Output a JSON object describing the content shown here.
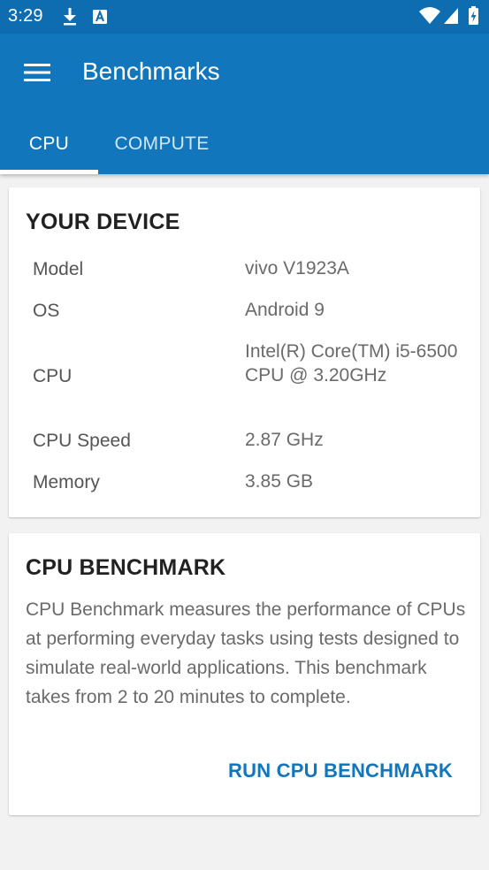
{
  "status_bar": {
    "time": "3:29",
    "icons": [
      "download-icon",
      "font-a-icon",
      "wifi-icon",
      "signal-icon",
      "battery-icon"
    ]
  },
  "app_bar": {
    "title": "Benchmarks",
    "menu_icon": "hamburger-menu-icon"
  },
  "tabs": [
    {
      "label": "CPU",
      "selected": true
    },
    {
      "label": "COMPUTE",
      "selected": false
    }
  ],
  "device_card": {
    "title": "YOUR DEVICE",
    "specs": [
      {
        "label": "Model",
        "value": "vivo V1923A"
      },
      {
        "label": "OS",
        "value": "Android 9"
      },
      {
        "label": "CPU",
        "value": "Intel(R) Core(TM) i5-6500 CPU @ 3.20GHz"
      },
      {
        "label": "CPU Speed",
        "value": "2.87 GHz"
      },
      {
        "label": "Memory",
        "value": "3.85 GB"
      }
    ]
  },
  "benchmark_card": {
    "title": "CPU BENCHMARK",
    "description": "CPU Benchmark measures the performance of CPUs at performing everyday tasks using tests designed to simulate real-world applications. This benchmark takes from 2 to 20 minutes to complete.",
    "run_label": "RUN CPU BENCHMARK"
  },
  "colors": {
    "status_bar": "#0d6db0",
    "app_bar": "#1276bd",
    "accent": "#1276bd",
    "background": "#f2f2f2"
  }
}
